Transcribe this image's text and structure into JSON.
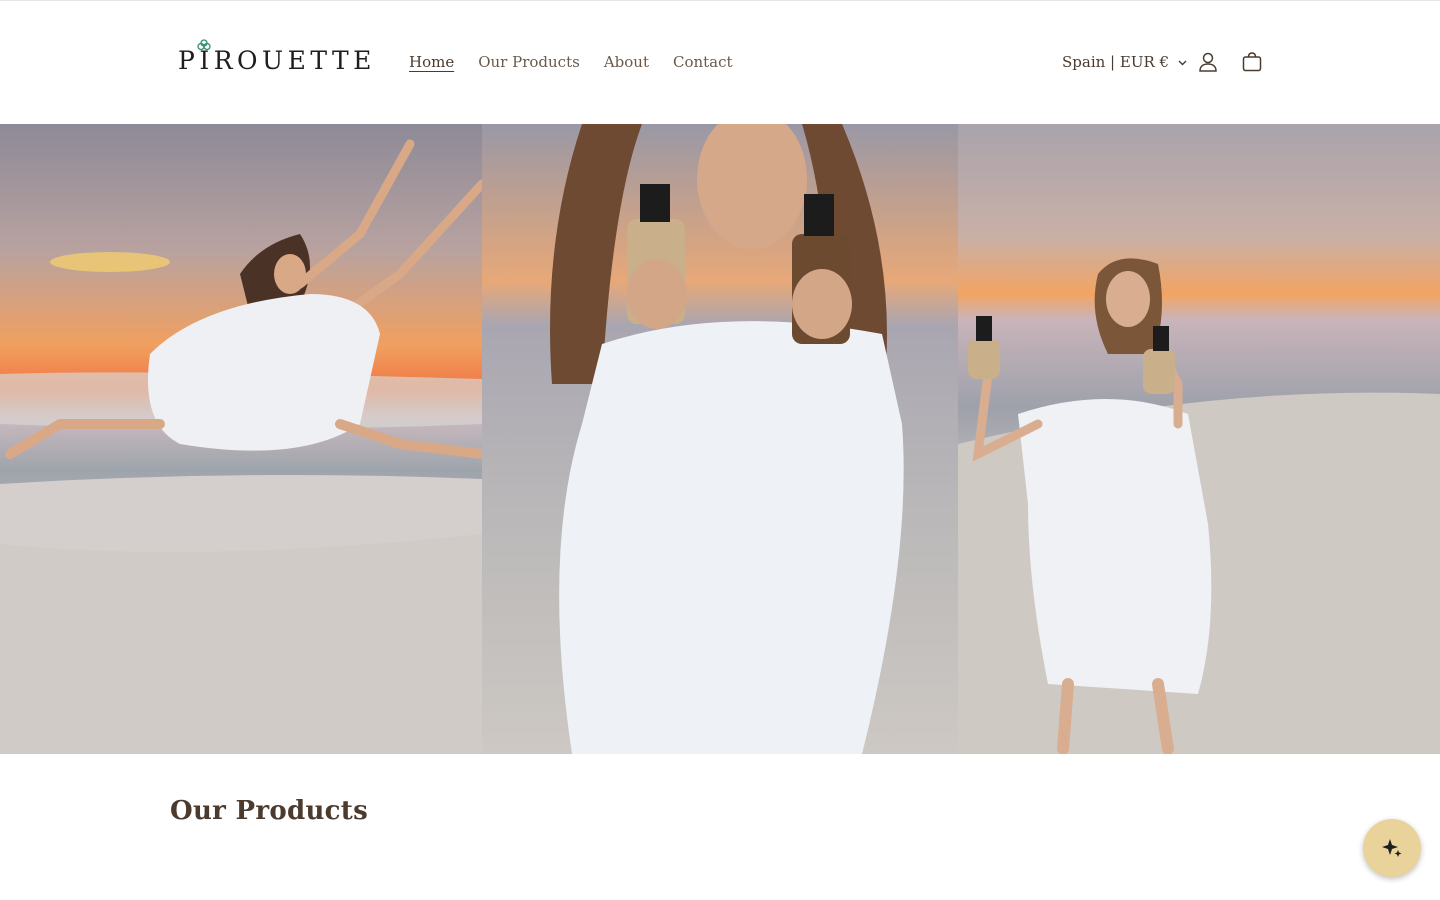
{
  "brand": {
    "name": "PIROUETTE",
    "accent": "#2f8f6f"
  },
  "nav": {
    "items": [
      {
        "label": "Home",
        "active": true
      },
      {
        "label": "Our Products",
        "active": false
      },
      {
        "label": "About",
        "active": false
      },
      {
        "label": "Contact",
        "active": false
      }
    ]
  },
  "header": {
    "locale_label": "Spain | EUR €",
    "icons": [
      "chevron-down-icon",
      "account-icon",
      "cart-icon"
    ]
  },
  "hero": {
    "panels": [
      "dancer-leaping-on-beach",
      "woman-holding-bottles-closeup",
      "woman-holding-bottles-on-beach"
    ]
  },
  "sections": {
    "products_title": "Our Products"
  },
  "chat": {
    "icon": "sparkle-icon",
    "color": "#e9d39b"
  }
}
